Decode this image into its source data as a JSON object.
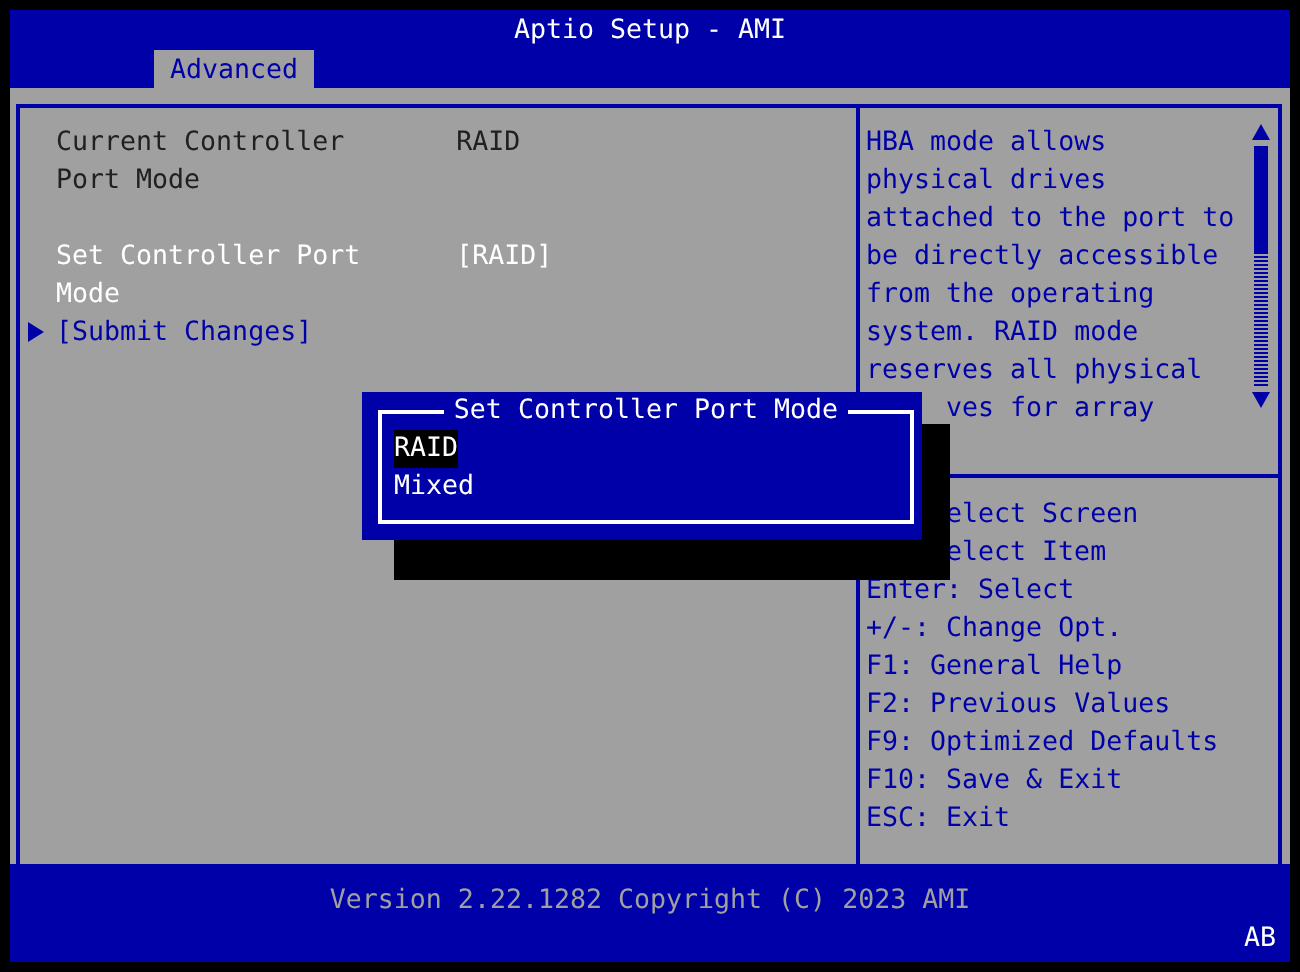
{
  "window": {
    "title": "Aptio Setup - AMI"
  },
  "tabs": [
    {
      "label": "Advanced",
      "selected": true
    }
  ],
  "settings": [
    {
      "kind": "info",
      "label": "Current Controller Port Mode",
      "value": "RAID"
    },
    {
      "kind": "option",
      "label": "Set Controller Port Mode",
      "value": "[RAID]",
      "selected": true
    },
    {
      "kind": "submenu",
      "label": "[Submit Changes]",
      "selected": false
    }
  ],
  "help_text": [
    {
      "kind": "full",
      "text": "HBA mode allows"
    },
    {
      "kind": "full",
      "text": "physical drives"
    },
    {
      "kind": "full",
      "text": "attached to the port to"
    },
    {
      "kind": "full",
      "text": "be directly accessible"
    },
    {
      "kind": "full",
      "text": "from the operating"
    },
    {
      "kind": "full",
      "text": "system. RAID mode"
    },
    {
      "kind": "full",
      "text": "reserves all physical"
    },
    {
      "kind": "partial",
      "text": "ves for array"
    }
  ],
  "key_hints": [
    {
      "kind": "partial",
      "text": "elect Screen"
    },
    {
      "kind": "partial",
      "text": "elect Item"
    },
    {
      "kind": "full",
      "text": "Enter: Select"
    },
    {
      "kind": "full",
      "text": "+/-: Change Opt."
    },
    {
      "kind": "full",
      "text": "F1: General Help"
    },
    {
      "kind": "full",
      "text": "F2: Previous Values"
    },
    {
      "kind": "full",
      "text": "F9: Optimized Defaults"
    },
    {
      "kind": "full",
      "text": "F10: Save & Exit"
    },
    {
      "kind": "full",
      "text": "ESC: Exit"
    }
  ],
  "popup": {
    "title": "Set Controller Port Mode",
    "options": [
      {
        "label": "RAID",
        "selected": true
      },
      {
        "label": "Mixed",
        "selected": false
      }
    ]
  },
  "status_bar": {
    "version": "Version 2.22.1282 Copyright (C) 2023 AMI",
    "badge": "AB"
  }
}
